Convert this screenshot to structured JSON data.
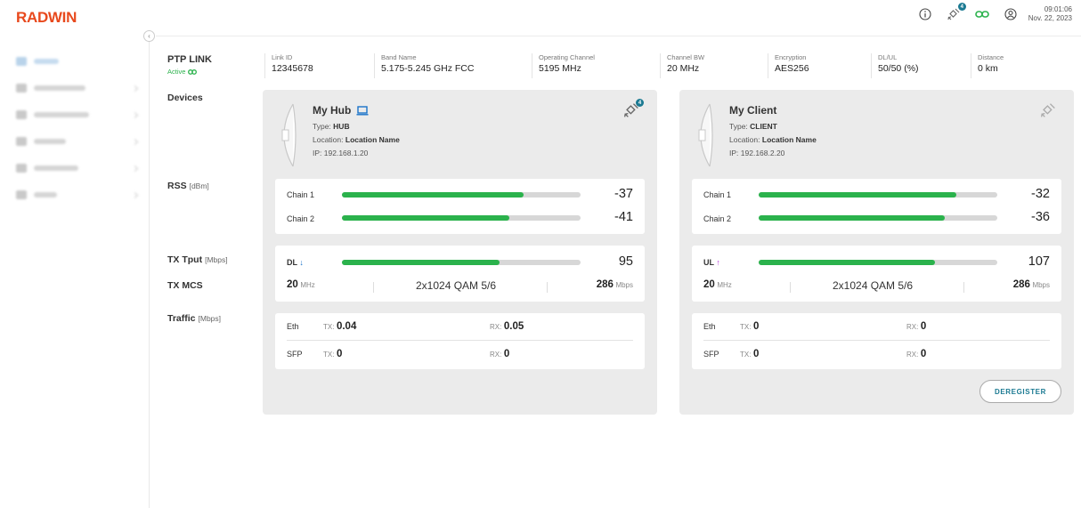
{
  "header": {
    "logo": "RADWIN",
    "time": "09:01:06",
    "date": "Nov. 22, 2023",
    "sat_badge": "4",
    "accent": "#1b7a92",
    "brand_color": "#e8491d"
  },
  "link": {
    "title": "PTP LINK",
    "status": "Active",
    "fields": [
      {
        "label": "Link ID",
        "value": "12345678"
      },
      {
        "label": "Band Name",
        "value": "5.175-5.245 GHz FCC"
      },
      {
        "label": "Operating Channel",
        "value": "5195 MHz"
      },
      {
        "label": "Channel BW",
        "value": "20 MHz"
      },
      {
        "label": "Encryption",
        "value": "AES256"
      },
      {
        "label": "DL/UL",
        "value": "50/50 (%)"
      },
      {
        "label": "Distance",
        "value": "0 km"
      }
    ]
  },
  "labels": {
    "devices": "Devices",
    "rss": "RSS",
    "rss_unit": "[dBm]",
    "tx_tput": "TX Tput",
    "tx_tput_unit": "[Mbps]",
    "tx_mcs": "TX MCS",
    "traffic": "Traffic",
    "traffic_unit": "[Mbps]"
  },
  "hub": {
    "name": "My Hub",
    "type_label": "Type:",
    "type": "HUB",
    "location_label": "Location:",
    "location": "Location Name",
    "ip_label": "IP:",
    "ip": "192.168.1.20",
    "sat_badge": "4",
    "chain1_label": "Chain 1",
    "chain1_value": "-37",
    "chain1_level": 0.76,
    "chain2_label": "Chain 2",
    "chain2_value": "-41",
    "chain2_level": 0.7,
    "dir_label": "DL",
    "dir_arrow": "↓",
    "tput_value": "95",
    "tput_level": 0.66,
    "bw_value": "20",
    "bw_unit": "MHz",
    "mcs": "2x1024 QAM 5/6",
    "rate_value": "286",
    "rate_unit": "Mbps",
    "eth_label": "Eth",
    "eth_tx_label": "TX:",
    "eth_tx": "0.04",
    "eth_rx_label": "RX:",
    "eth_rx": "0.05",
    "sfp_label": "SFP",
    "sfp_tx_label": "TX:",
    "sfp_tx": "0",
    "sfp_rx_label": "RX:",
    "sfp_rx": "0"
  },
  "client": {
    "name": "My Client",
    "type_label": "Type:",
    "type": "CLIENT",
    "location_label": "Location:",
    "location": "Location Name",
    "ip_label": "IP:",
    "ip": "192.168.2.20",
    "chain1_label": "Chain 1",
    "chain1_value": "-32",
    "chain1_level": 0.83,
    "chain2_label": "Chain 2",
    "chain2_value": "-36",
    "chain2_level": 0.78,
    "dir_label": "UL",
    "dir_arrow": "↑",
    "tput_value": "107",
    "tput_level": 0.74,
    "bw_value": "20",
    "bw_unit": "MHz",
    "mcs": "2x1024 QAM 5/6",
    "rate_value": "286",
    "rate_unit": "Mbps",
    "eth_label": "Eth",
    "eth_tx_label": "TX:",
    "eth_tx": "0",
    "eth_rx_label": "RX:",
    "eth_rx": "0",
    "sfp_label": "SFP",
    "sfp_tx_label": "TX:",
    "sfp_tx": "0",
    "sfp_rx_label": "RX:",
    "sfp_rx": "0",
    "deregister": "DEREGISTER"
  }
}
